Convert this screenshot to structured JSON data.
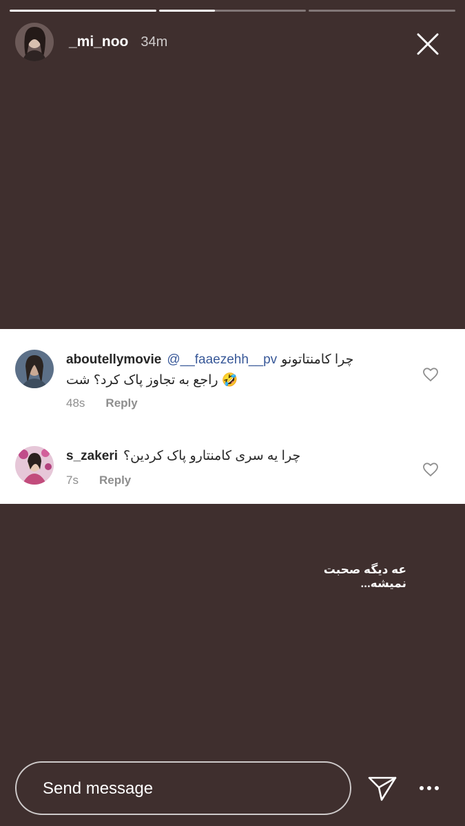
{
  "story": {
    "progress": [
      1.0,
      0.38,
      0.0
    ],
    "username": "_mi_noo",
    "time": "34m",
    "close_icon": "close-icon",
    "caption": "عه دیگه صحبت نمیشه..."
  },
  "comments": [
    {
      "username": "aboutellymovie",
      "mention": "@__faaezehh__pv",
      "text_line1": "چرا کامنتاتونو",
      "text_line2": "راجع به تجاوز پاک کرد؟ شت",
      "emoji": "🤣",
      "time": "48s",
      "reply": "Reply"
    },
    {
      "username": "s_zakeri",
      "text_line1": "چرا یه سری کامنتارو پاک کردین؟",
      "time": "7s",
      "reply": "Reply"
    }
  ],
  "footer": {
    "placeholder": "Send message",
    "send_icon": "paper-plane-icon",
    "more_icon": "more-dots-icon"
  },
  "colors": {
    "background": "#3f2f2e",
    "mention": "#385898",
    "meta": "#8e8e8e"
  }
}
